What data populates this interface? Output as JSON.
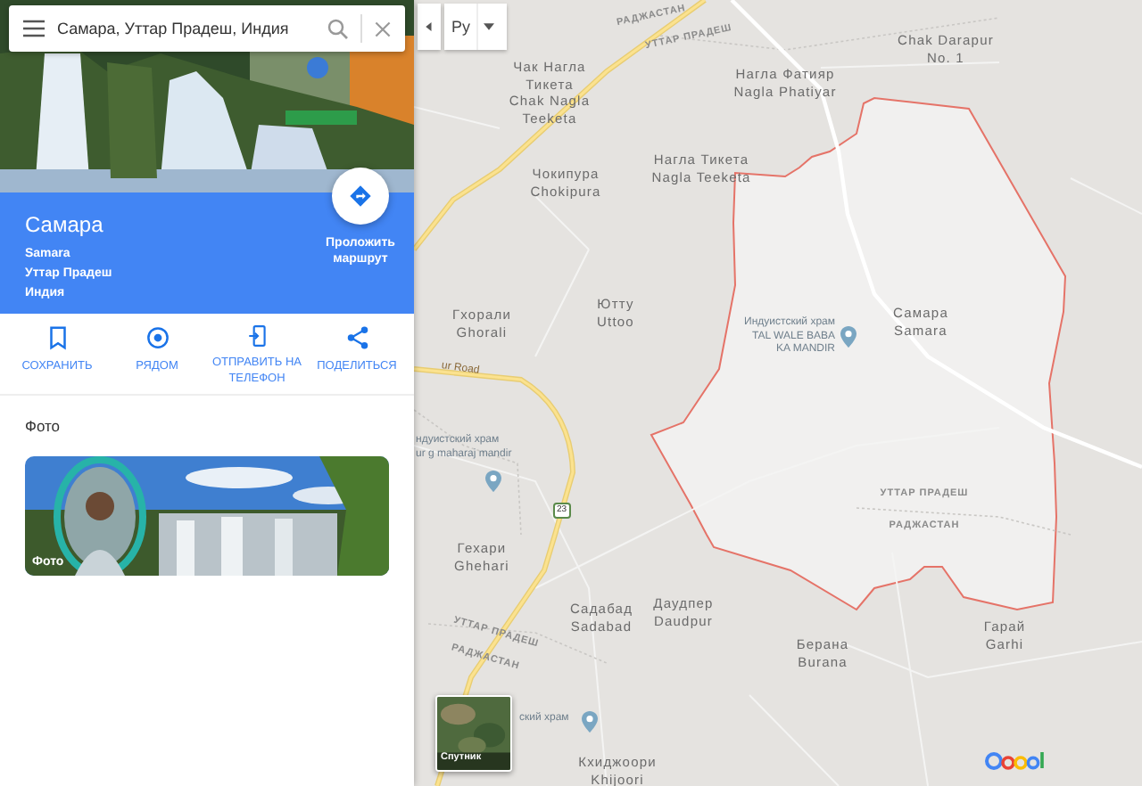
{
  "search": {
    "value": "Самара, Уттар Прадеш, Индия"
  },
  "place": {
    "name": "Самара",
    "lines": [
      "Samara",
      "Уттар Прадеш",
      "Индия"
    ]
  },
  "route_button": {
    "label": "Проложить маршрут"
  },
  "actions": [
    {
      "kind": "save",
      "label": "СОХРАНИТЬ"
    },
    {
      "kind": "nearby",
      "label": "РЯДОМ"
    },
    {
      "kind": "send",
      "label": "ОТПРАВИТЬ НА ТЕЛЕФОН"
    },
    {
      "kind": "share",
      "label": "ПОДЕЛИТЬСЯ"
    }
  ],
  "photos": {
    "heading": "Фото",
    "card_label": "Фото"
  },
  "map": {
    "language": "Ру",
    "labels": [
      {
        "kind": "border",
        "lines": [
          "РАДЖАСТАН"
        ]
      },
      {
        "kind": "border",
        "lines": [
          "УТТАР ПРАДЕШ"
        ]
      },
      {
        "kind": "place",
        "lines": [
          "Чак Нагла",
          "Тикета",
          "Chak Nagla",
          "Teeketa"
        ]
      },
      {
        "kind": "place",
        "lines": [
          "Chak Darapur",
          "No. 1"
        ]
      },
      {
        "kind": "place",
        "lines": [
          "Нагла Фатияр",
          "Nagla Phatiyar"
        ]
      },
      {
        "kind": "place",
        "lines": [
          "Нагла Тикета",
          "Nagla Teeketa"
        ]
      },
      {
        "kind": "place",
        "lines": [
          "Чокипура",
          "Chokipura"
        ]
      },
      {
        "kind": "place",
        "lines": [
          "Ютту",
          "Uttoo"
        ]
      },
      {
        "kind": "place",
        "lines": [
          "Гхорали",
          "Ghorali"
        ]
      },
      {
        "kind": "place",
        "lines": [
          "Самара",
          "Samara"
        ]
      },
      {
        "kind": "poi",
        "lines": [
          "Индуистский храм",
          "TAL WALE BABA",
          "KA MANDIR"
        ]
      },
      {
        "kind": "road",
        "lines": [
          "ur Road"
        ]
      },
      {
        "kind": "poi",
        "lines": [
          "ндуистский храм",
          "ur g maharaj mandir"
        ]
      },
      {
        "kind": "border",
        "lines": [
          "УТТАР ПРАДЕШ"
        ]
      },
      {
        "kind": "border",
        "lines": [
          "РАДЖАСТАН"
        ]
      },
      {
        "kind": "place",
        "lines": [
          "Гехари",
          "Ghehari"
        ]
      },
      {
        "kind": "place",
        "lines": [
          "Садабад",
          "Sadabad"
        ]
      },
      {
        "kind": "place",
        "lines": [
          "Даудпер",
          "Daudpur"
        ]
      },
      {
        "kind": "place",
        "lines": [
          "Берана",
          "Burana"
        ]
      },
      {
        "kind": "place",
        "lines": [
          "Гарай",
          "Garhi"
        ]
      },
      {
        "kind": "border",
        "lines": [
          "УТТАР ПРАДЕШ"
        ]
      },
      {
        "kind": "border",
        "lines": [
          "РАДЖАСТАН"
        ]
      },
      {
        "kind": "poi",
        "lines": [
          "ский храм"
        ]
      },
      {
        "kind": "place",
        "lines": [
          "Кхиджоори",
          "Khijoori"
        ]
      }
    ],
    "route_shields": [
      "23"
    ],
    "layer_button": {
      "label": "Спутник"
    }
  }
}
